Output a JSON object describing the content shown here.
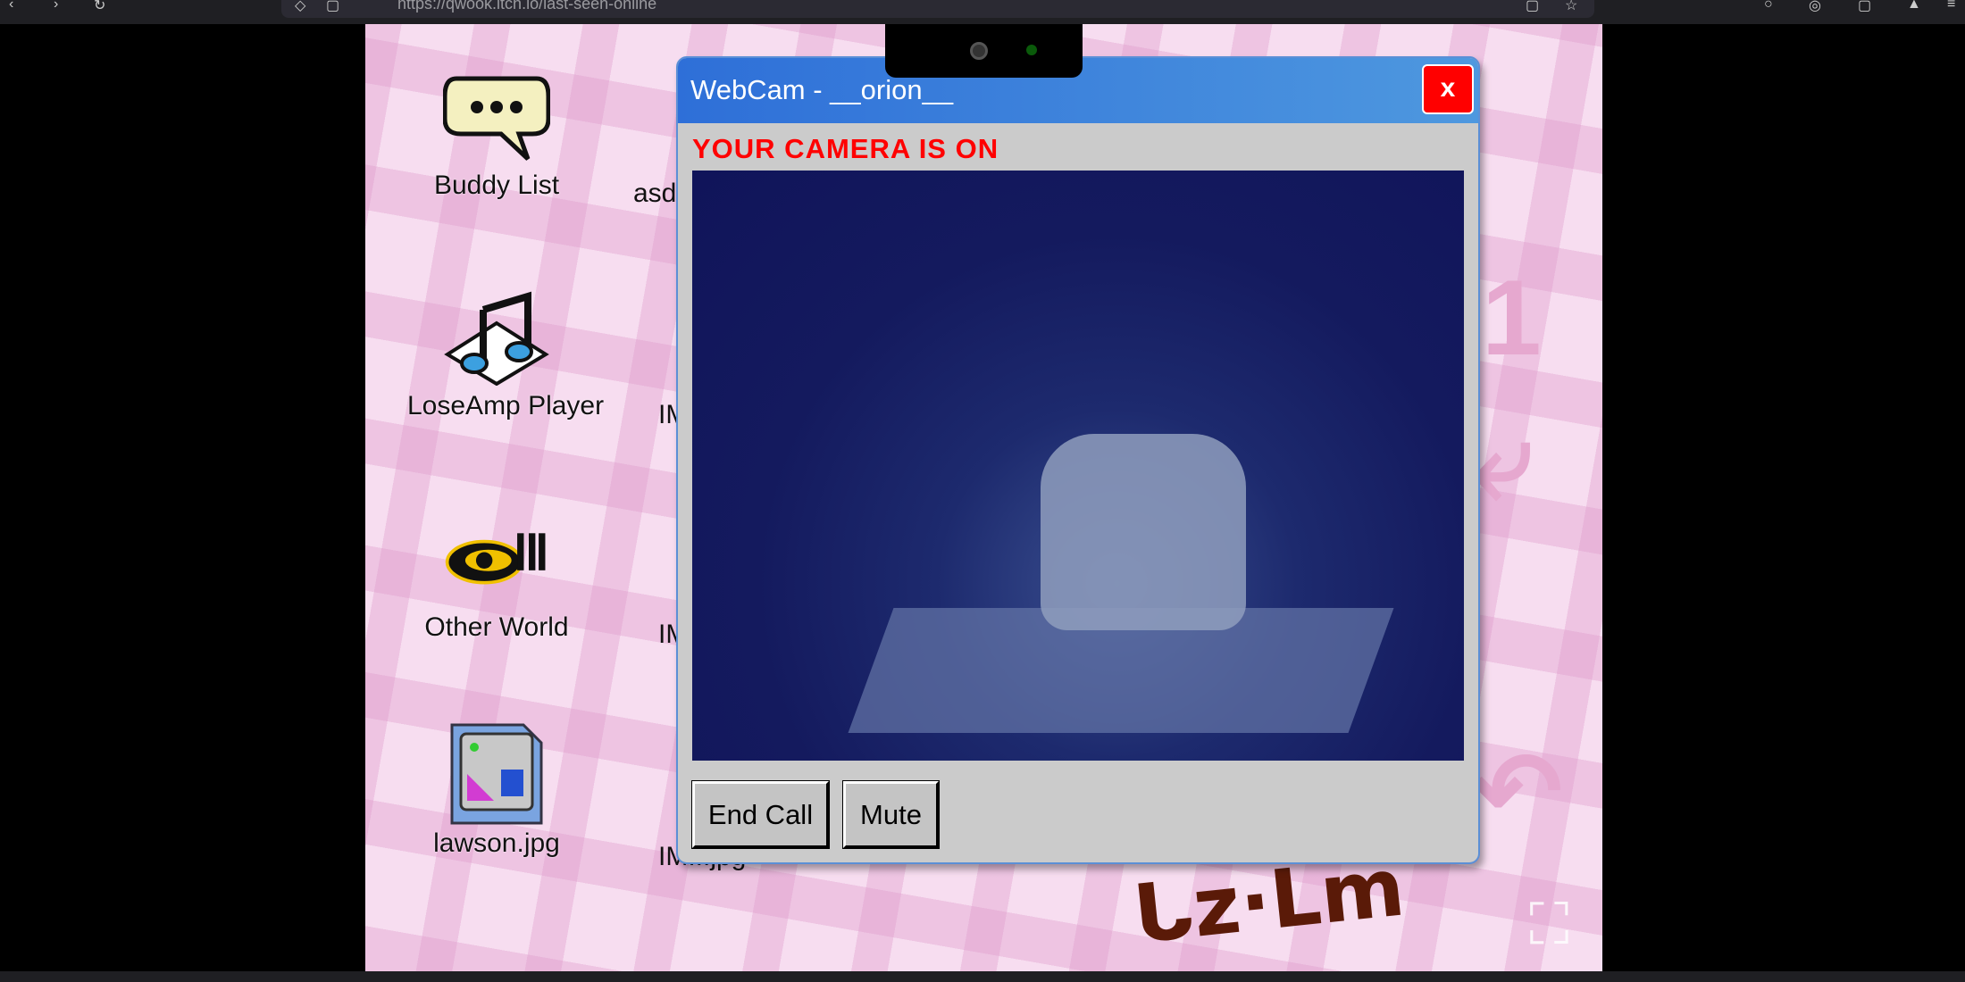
{
  "browser": {
    "url": "https://qwook.itch.io/last-seen-online"
  },
  "desktop": {
    "icons": [
      {
        "label": "Buddy List",
        "icon": "speech-bubble-icon"
      },
      {
        "label": "LoseAmp Player",
        "icon": "music-note-icon"
      },
      {
        "label": "Other World",
        "icon": "other-world-logo-icon"
      },
      {
        "label": "lawson.jpg",
        "icon": "image-file-icon"
      }
    ],
    "partial_labels": [
      "asd",
      "IM",
      "IM",
      "IM...jpg"
    ]
  },
  "webcam_window": {
    "title": "WebCam - __orion__",
    "close_label": "x",
    "status": "YOUR CAMERA IS ON",
    "buttons": {
      "end_call": "End Call",
      "mute": "Mute"
    }
  },
  "colors": {
    "title_bar": "#2e6fd8",
    "close": "#ff0000",
    "status": "#ff0000",
    "desktop_bg": "#f7ddf0"
  }
}
